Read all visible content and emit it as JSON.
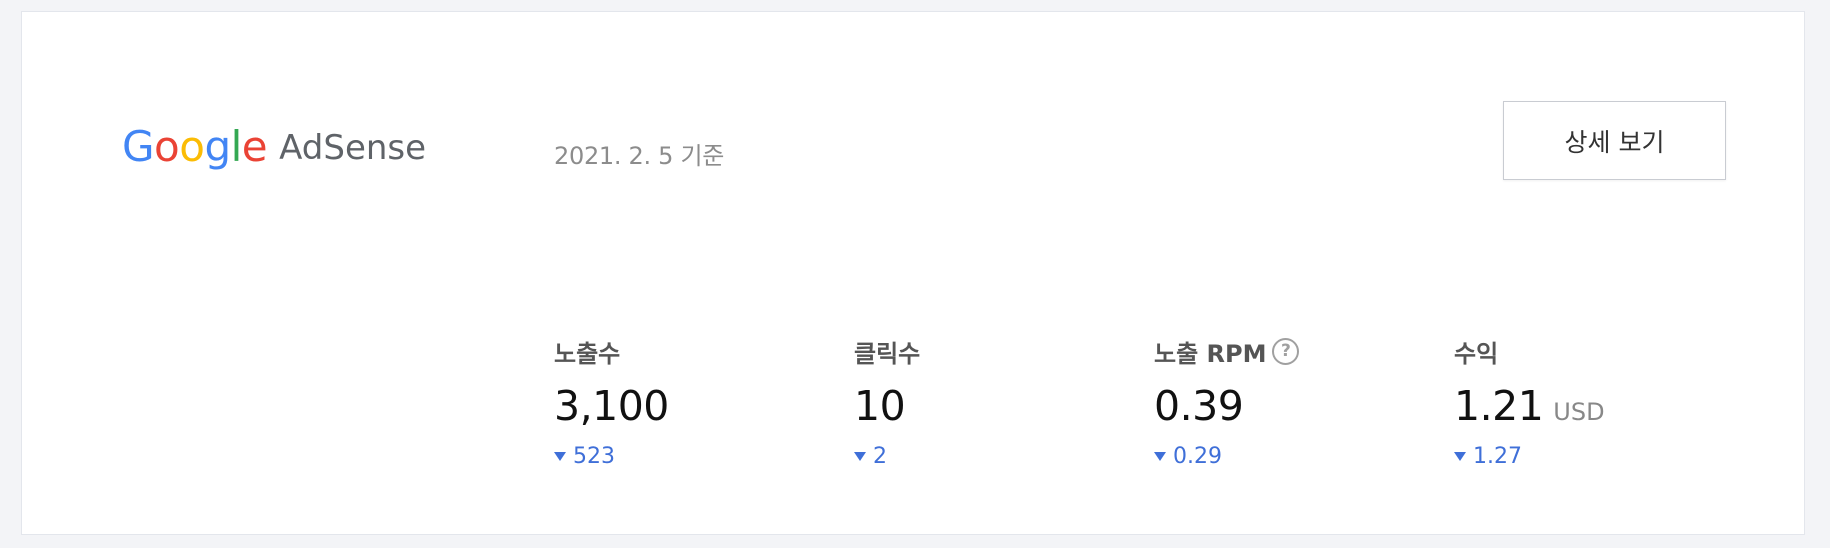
{
  "brand": {
    "google_letters": [
      "G",
      "o",
      "o",
      "g",
      "l",
      "e"
    ],
    "product": "AdSense",
    "colors": {
      "blue": "#4285f4",
      "red": "#ea4335",
      "yellow": "#fbbc05",
      "green": "#34a853",
      "gray": "#5f6368"
    }
  },
  "header": {
    "date": "2021. 2. 5 기준",
    "detail_button": "상세 보기"
  },
  "stats": [
    {
      "label": "노출수",
      "value": "3,100",
      "unit": "",
      "change": "523",
      "trend": "down",
      "has_help": false
    },
    {
      "label": "클릭수",
      "value": "10",
      "unit": "",
      "change": "2",
      "trend": "down",
      "has_help": false
    },
    {
      "label": "노출 RPM",
      "value": "0.39",
      "unit": "",
      "change": "0.29",
      "trend": "down",
      "has_help": true,
      "help_symbol": "?"
    },
    {
      "label": "수익",
      "value": "1.21",
      "unit": "USD",
      "change": "1.27",
      "trend": "down",
      "has_help": false
    }
  ],
  "theme": {
    "change_color": "#3f6fd8"
  }
}
